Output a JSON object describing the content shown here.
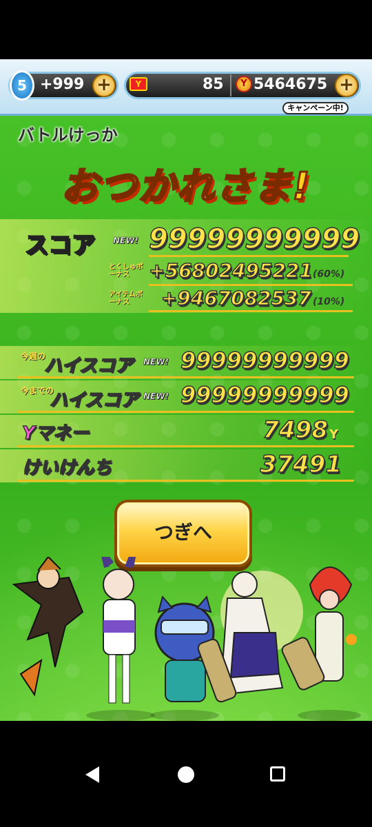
{
  "currency_bar": {
    "stamina_level": "5",
    "stamina_value": "+999",
    "tickets": "85",
    "ymoney": "5464675",
    "campaign_label": "キャンペーン中!"
  },
  "result": {
    "section_label": "バトルけっか",
    "title": "おつかれさま!",
    "score_label": "スコア",
    "new_tag": "NEW!",
    "score_value": "99999999999",
    "special_bonus_label": "とくしゅボーナス",
    "special_bonus_value": "+56802495221",
    "special_bonus_pct": "(60%)",
    "item_bonus_label": "アイテムボーナス",
    "item_bonus_value": "+9467082537",
    "item_bonus_pct": "(10%)",
    "week_prefix": "今週の",
    "week_highscore_label": "ハイスコア",
    "week_highscore_value": "99999999999",
    "alltime_prefix": "今までの",
    "alltime_highscore_label": "ハイスコア",
    "alltime_highscore_value": "99999999999",
    "ymoney_label": "Yマネー",
    "ymoney_value": "7498",
    "ymoney_unit": "Y",
    "exp_label": "けいけんち",
    "exp_value": "37491"
  },
  "next_button": {
    "label": "つぎへ"
  },
  "colors": {
    "panel_green": "#3fb822",
    "title_yellow": "#ffd21f",
    "number_yellow": "#ffe24a",
    "button_orange": "#ffd447"
  },
  "icons": [
    "stamina-icon",
    "plus-icon",
    "ticket-icon",
    "ymoney-icon",
    "back-nav-icon",
    "home-nav-icon",
    "recents-nav-icon"
  ]
}
